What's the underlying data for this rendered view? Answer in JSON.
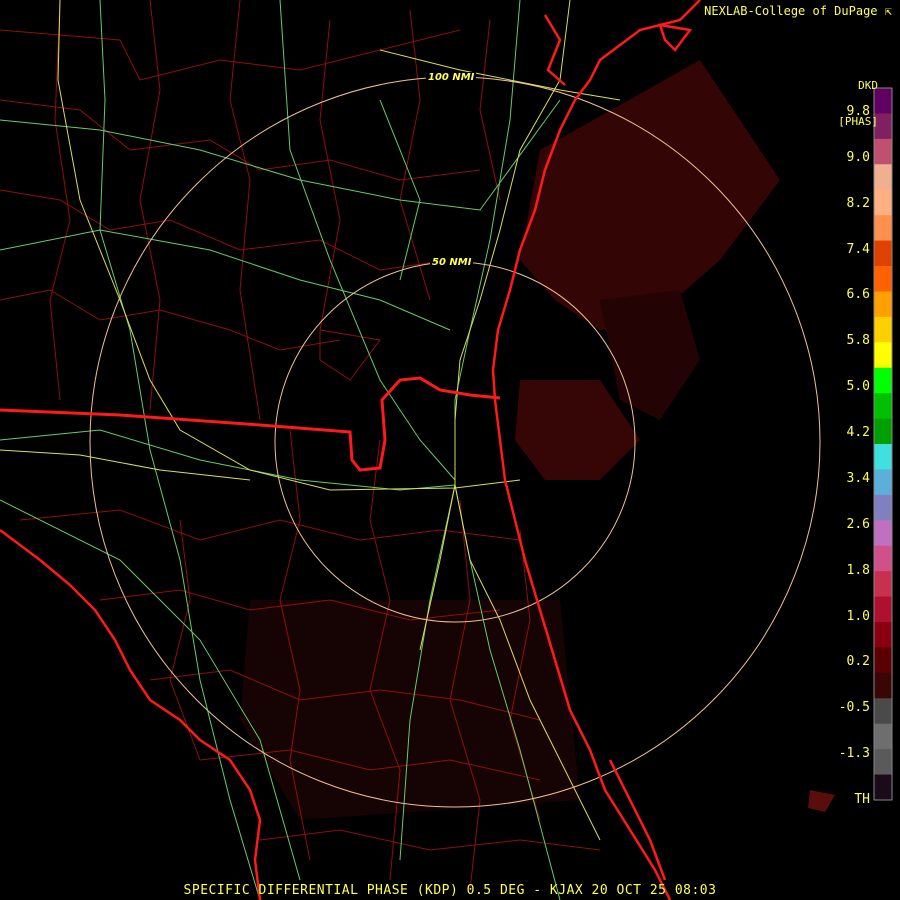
{
  "credit": "NEXLAB-College of DuPage",
  "product": {
    "code": "DKD",
    "unit": "[PHAS]"
  },
  "footer": "SPECIFIC DIFFERENTIAL PHASE (KDP) 0.5 DEG - KJAX 20 OCT 25 08:03",
  "range_rings": [
    {
      "label": "100 NMI"
    },
    {
      "label": "50 NMI"
    }
  ],
  "scale_labels": [
    "9.8",
    "9.0",
    "8.2",
    "7.4",
    "6.6",
    "5.8",
    "5.0",
    "4.2",
    "3.4",
    "2.6",
    "1.8",
    "1.0",
    "0.2",
    "-0.5",
    "-1.3",
    "TH"
  ],
  "colors": {
    "background": "#000000",
    "state_border": "#ff0000",
    "county_border": "#b01010",
    "highway_green": "#66cc66",
    "highway_yellow": "#dddd55",
    "range_ring": "#f0c090",
    "label_text": "#ffff55",
    "echo": "#6a0f0f"
  },
  "color_scale": [
    "#1a0a1a",
    "#5a5a5a",
    "#6e6e6e",
    "#4a4a4a",
    "#3a0505",
    "#5a0000",
    "#8a0010",
    "#b01030",
    "#c83050",
    "#d0508a",
    "#c070c0",
    "#8080c0",
    "#5ab0d8",
    "#40e0e0",
    "#00a000",
    "#00c000",
    "#00ff00",
    "#ffff00",
    "#ffd000",
    "#ffa000",
    "#ff6000",
    "#e04000",
    "#ff9050",
    "#ffb080",
    "#f0b090",
    "#c05070",
    "#802060",
    "#600060"
  ]
}
